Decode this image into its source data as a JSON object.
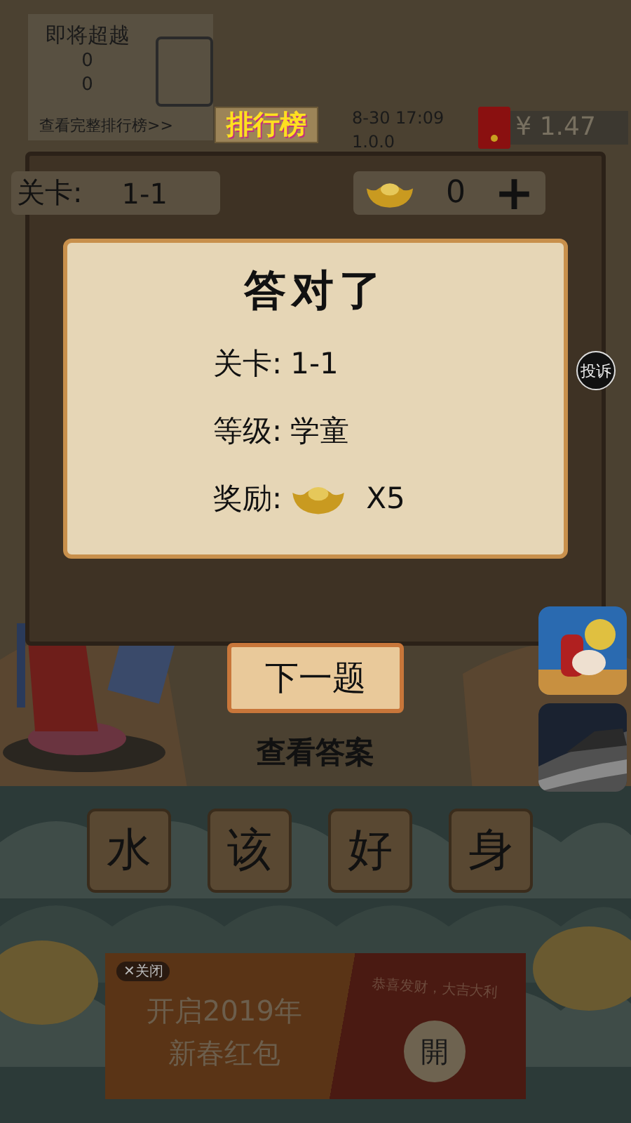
{
  "rank_panel": {
    "title": "即将超越",
    "values": [
      "0",
      "0"
    ],
    "link": "查看完整排行榜>>"
  },
  "rank_badge": "排行榜",
  "info": {
    "time": "8-30 17:09",
    "version": "1.0.0"
  },
  "wallet": {
    "amount": "¥ 1.47"
  },
  "level_bar": {
    "label": "关卡:",
    "value": "1-1"
  },
  "gold": {
    "count": "0",
    "add": "+"
  },
  "dialog": {
    "title": "答对了",
    "rows": [
      {
        "kind": "text",
        "label": "关卡:",
        "value": "1-1"
      },
      {
        "kind": "text",
        "label": "等级:",
        "value": "学童"
      },
      {
        "kind": "reward",
        "label": "奖励:",
        "value": "X5"
      }
    ]
  },
  "complaint_button": "投诉",
  "next_button": "下一题",
  "answer_link": "查看答案",
  "tiles": [
    "水",
    "该",
    "好",
    "身"
  ],
  "ad": {
    "close": "✕关闭",
    "headline": [
      "开启2019年",
      "新春红包"
    ],
    "greeting": "恭喜发财，大吉大利",
    "open": "開"
  }
}
